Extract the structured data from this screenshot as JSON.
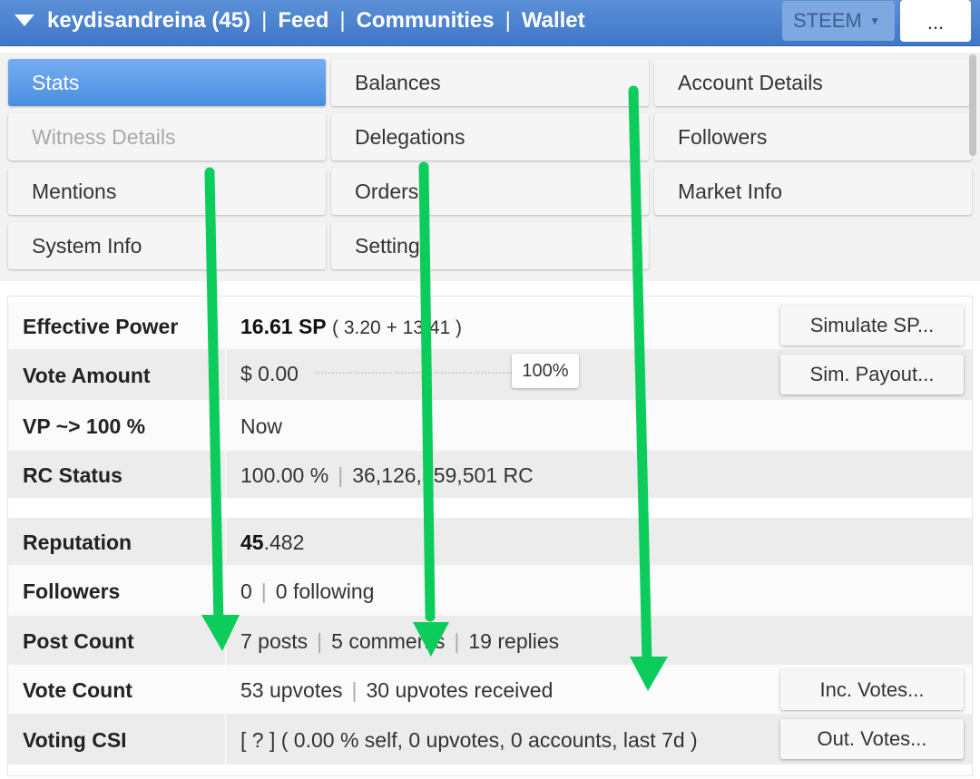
{
  "topbar": {
    "account": "keydisandreina (45)",
    "links": [
      "Feed",
      "Communities",
      "Wallet"
    ],
    "separator": "|",
    "currency": "STEEM",
    "currency_caret": "▼",
    "more": "..."
  },
  "tabs": {
    "stats": "Stats",
    "balances": "Balances",
    "account_details": "Account Details",
    "witness_details": "Witness Details",
    "delegations": "Delegations",
    "followers": "Followers",
    "mentions": "Mentions",
    "orders": "Orders",
    "market_info": "Market Info",
    "system_info": "System Info",
    "settings": "Settings"
  },
  "stats": {
    "effective_power": {
      "label": "Effective Power",
      "value": "16.61 SP",
      "detail": "( 3.20 + 13.41 )",
      "button": "Simulate SP..."
    },
    "vote_amount": {
      "label": "Vote Amount",
      "value": "$ 0.00",
      "percent": "100%",
      "button": "Sim. Payout..."
    },
    "vp": {
      "label": "VP ~> 100 %",
      "value": "Now"
    },
    "rc_status": {
      "label": "RC Status",
      "percent": "100.00 %",
      "rc": "36,126,559,501 RC"
    },
    "reputation": {
      "label": "Reputation",
      "int": "45",
      "dec": ".482"
    },
    "followers": {
      "label": "Followers",
      "followers": "0",
      "following": "0 following"
    },
    "post_count": {
      "label": "Post Count",
      "posts": "7 posts",
      "comments": "5 comments",
      "replies": "19 replies"
    },
    "vote_count": {
      "label": "Vote Count",
      "upvotes": "53 upvotes",
      "received": "30 upvotes received",
      "button": "Inc. Votes..."
    },
    "voting_csi": {
      "label": "Voting CSI",
      "value": "[ ? ] ( 0.00 % self, 0 upvotes, 0 accounts, last 7d )",
      "button": "Out. Votes..."
    },
    "pipe": "|"
  },
  "colors": {
    "topbar": "#4a82cf",
    "active_tab": "#4a8fe0",
    "arrow": "#0ccc5c"
  }
}
